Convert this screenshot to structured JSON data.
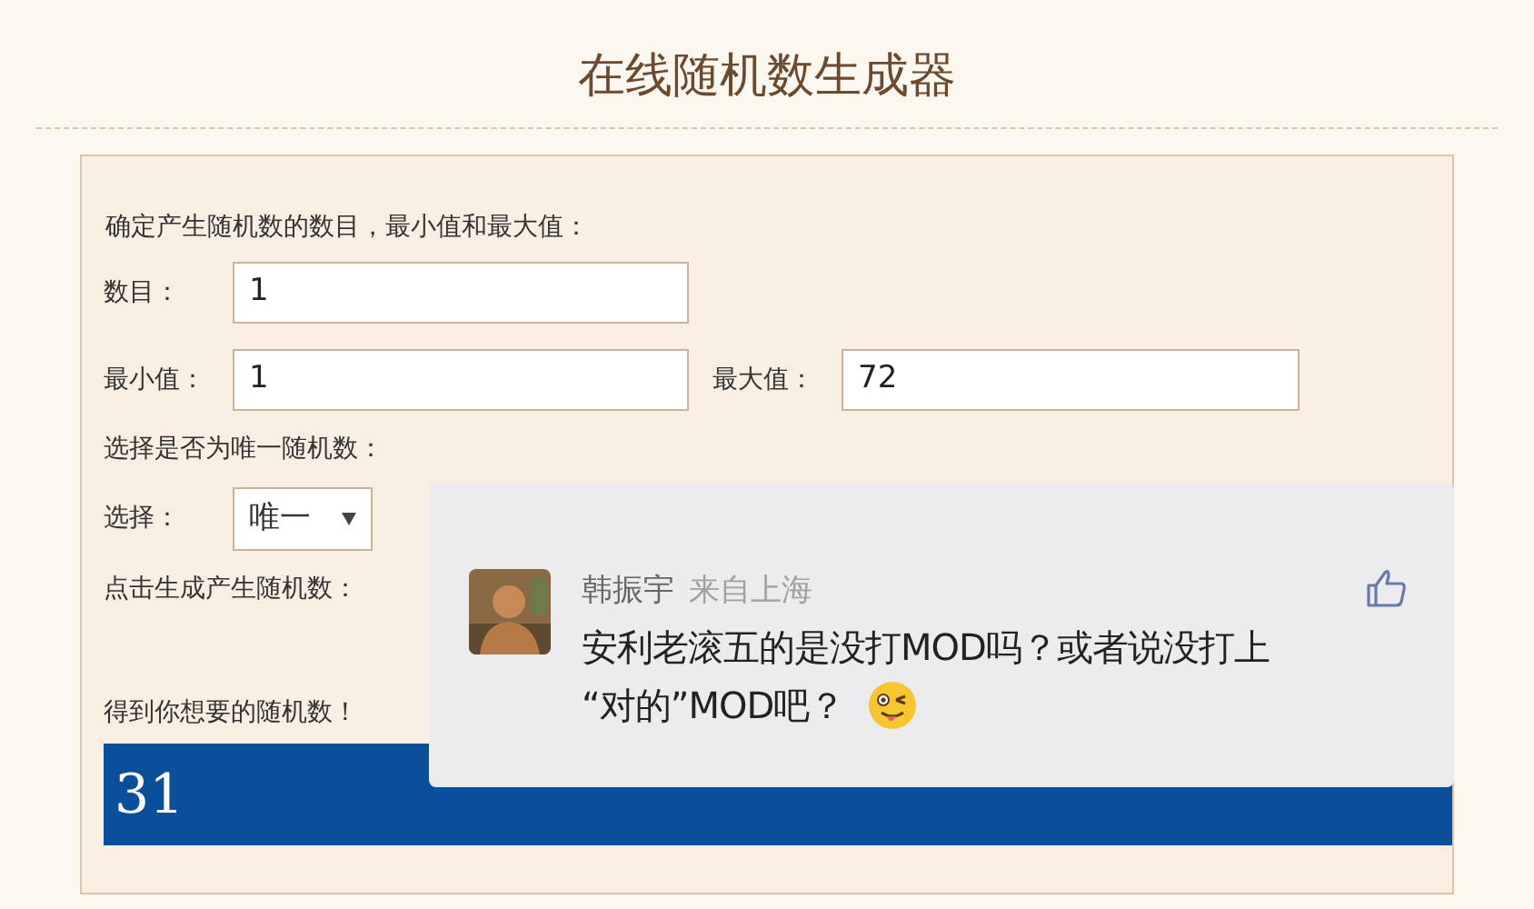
{
  "title": "在线随机数生成器",
  "form": {
    "intro": "确定产生随机数的数目，最小值和最大值：",
    "count": {
      "label": "数目：",
      "value": "1"
    },
    "min": {
      "label": "最小值：",
      "value": "1"
    },
    "max": {
      "label": "最大值：",
      "value": "72"
    },
    "unique_prompt": "选择是否为唯一随机数：",
    "choice": {
      "label": "选择：",
      "value": "唯一"
    },
    "generate_prompt": "点击生成产生随机数：",
    "result_prompt": "得到你想要的随机数！",
    "result": "31"
  },
  "comment": {
    "user": "韩振宇",
    "location": "来自上海",
    "text_lines": [
      "安利老滚五的是没打MOD吗？或者说没打上",
      "“对的”MOD吧？"
    ],
    "liked": false
  }
}
